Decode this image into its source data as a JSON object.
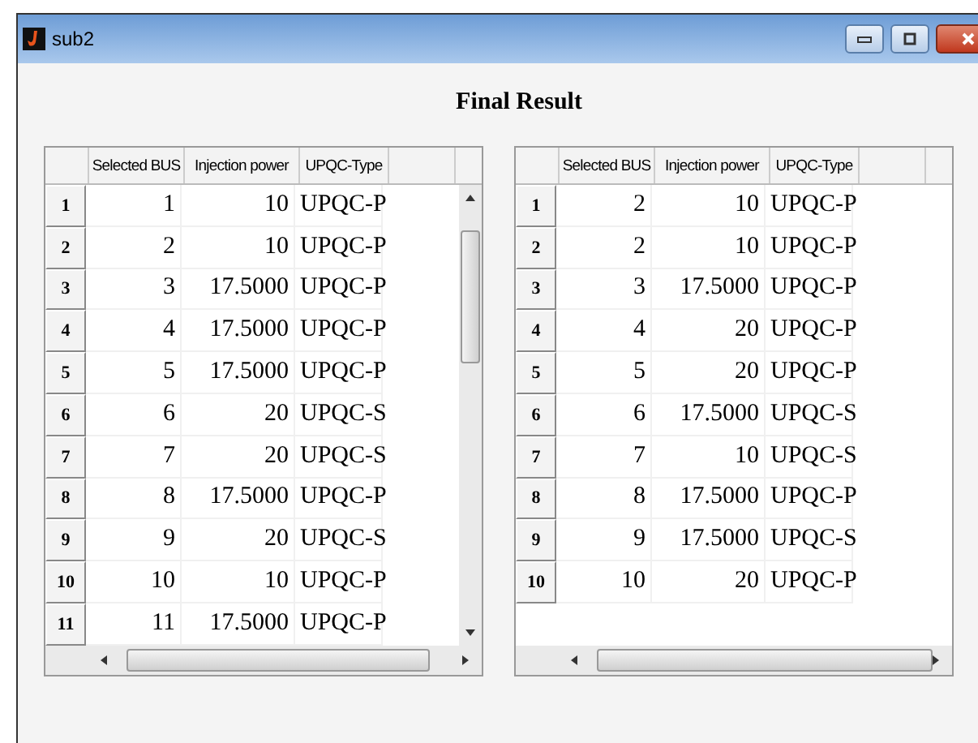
{
  "window": {
    "title": "sub2"
  },
  "heading": "Final Result",
  "tables": [
    {
      "columns": [
        "Selected BUS",
        "Injection power",
        "UPQC-Type"
      ],
      "vertical_scrollbar": true,
      "rows": [
        {
          "number": "1",
          "cells": [
            "1",
            "10",
            "UPQC-P"
          ]
        },
        {
          "number": "2",
          "cells": [
            "2",
            "10",
            "UPQC-P"
          ]
        },
        {
          "number": "3",
          "cells": [
            "3",
            "17.5000",
            "UPQC-P"
          ]
        },
        {
          "number": "4",
          "cells": [
            "4",
            "17.5000",
            "UPQC-P"
          ]
        },
        {
          "number": "5",
          "cells": [
            "5",
            "17.5000",
            "UPQC-P"
          ]
        },
        {
          "number": "6",
          "cells": [
            "6",
            "20",
            "UPQC-S"
          ]
        },
        {
          "number": "7",
          "cells": [
            "7",
            "20",
            "UPQC-S"
          ]
        },
        {
          "number": "8",
          "cells": [
            "8",
            "17.5000",
            "UPQC-P"
          ]
        },
        {
          "number": "9",
          "cells": [
            "9",
            "20",
            "UPQC-S"
          ]
        },
        {
          "number": "10",
          "cells": [
            "10",
            "10",
            "UPQC-P"
          ]
        },
        {
          "number": "11",
          "cells": [
            "11",
            "17.5000",
            "UPQC-P"
          ]
        }
      ]
    },
    {
      "columns": [
        "Selected BUS",
        "Injection power",
        "UPQC-Type"
      ],
      "vertical_scrollbar": false,
      "rows": [
        {
          "number": "1",
          "cells": [
            "2",
            "10",
            "UPQC-P"
          ]
        },
        {
          "number": "2",
          "cells": [
            "2",
            "10",
            "UPQC-P"
          ]
        },
        {
          "number": "3",
          "cells": [
            "3",
            "17.5000",
            "UPQC-P"
          ]
        },
        {
          "number": "4",
          "cells": [
            "4",
            "20",
            "UPQC-P"
          ]
        },
        {
          "number": "5",
          "cells": [
            "5",
            "20",
            "UPQC-P"
          ]
        },
        {
          "number": "6",
          "cells": [
            "6",
            "17.5000",
            "UPQC-S"
          ]
        },
        {
          "number": "7",
          "cells": [
            "7",
            "10",
            "UPQC-S"
          ]
        },
        {
          "number": "8",
          "cells": [
            "8",
            "17.5000",
            "UPQC-P"
          ]
        },
        {
          "number": "9",
          "cells": [
            "9",
            "17.5000",
            "UPQC-S"
          ]
        },
        {
          "number": "10",
          "cells": [
            "10",
            "20",
            "UPQC-P"
          ]
        }
      ]
    }
  ]
}
